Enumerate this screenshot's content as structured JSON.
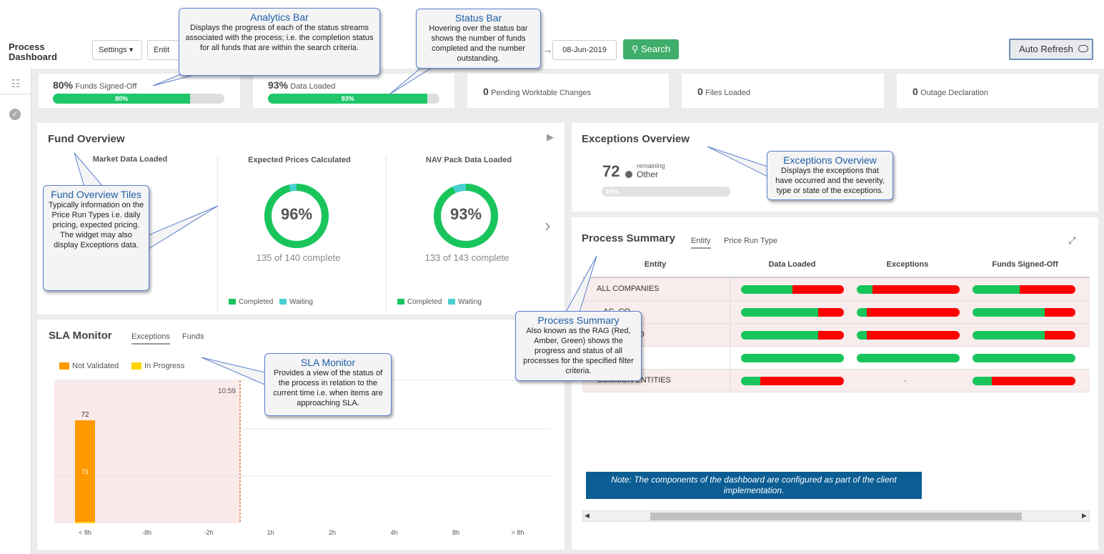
{
  "header": {
    "title": "Process Dashboard",
    "settings_label": "Settings ▾",
    "entity_stub": "Entit",
    "date": "08-Jun-2019",
    "search_label": "Search",
    "auto_refresh_label": "Auto Refresh"
  },
  "stats": [
    {
      "value": "80%",
      "label": "Funds Signed-Off",
      "bar_text": "80%",
      "progress": 0.8
    },
    {
      "value": "93%",
      "label": "Data Loaded",
      "bar_text": "93%",
      "progress": 0.93
    },
    {
      "value": "0",
      "label": "Pending Worktable Changes"
    },
    {
      "value": "0",
      "label": "Files Loaded"
    },
    {
      "value": "0",
      "label": "Outage Declaration"
    }
  ],
  "fund_overview": {
    "title": "Fund Overview",
    "tiles": [
      {
        "title": "Market Data Loaded"
      },
      {
        "title": "Expected Prices Calculated",
        "pct": "96%",
        "fraction": 0.96,
        "sub": "135 of 140 complete",
        "legend_completed": "Completed",
        "legend_waiting": "Waiting"
      },
      {
        "title": "NAV Pack Data Loaded",
        "pct": "93%",
        "fraction": 0.93,
        "sub": "133 of 143 complete",
        "legend_completed": "Completed",
        "legend_waiting": "Waiting"
      }
    ]
  },
  "exceptions_overview": {
    "title": "Exceptions Overview",
    "count": "72",
    "remaining": "remaining",
    "type": "Other",
    "bar_text": "16%",
    "progress": 0.16
  },
  "process_summary": {
    "title": "Process Summary",
    "tab_entity": "Entity",
    "tab_price_run": "Price Run Type",
    "columns": [
      "Entity",
      "Data Loaded",
      "Exceptions",
      "Funds Signed-Off"
    ],
    "rows": [
      {
        "label": "ALL COMPANIES",
        "data_loaded": 0.5,
        "exceptions": 0.15,
        "funds": 0.46
      },
      {
        "label": "...AC_CO",
        "data_loaded": 0.75,
        "exceptions": 0.1,
        "funds": 0.7
      },
      {
        "label": "EMEA  DEMO",
        "data_loaded": 0.75,
        "exceptions": 0.1,
        "funds": 0.7
      },
      {
        "label": "...SES",
        "data_loaded": 1.0,
        "exceptions": 1.0,
        "funds": 1.0
      },
      {
        "label": "COMMON  ENTITIES",
        "data_loaded": 0.19,
        "exceptions": null,
        "exceptions_text": "-",
        "funds": 0.19
      }
    ]
  },
  "sla_monitor": {
    "title": "SLA Monitor",
    "tab_exceptions": "Exceptions",
    "tab_funds": "Funds",
    "legend_not_validated": "Not Validated",
    "legend_in_progress": "In Progress",
    "now_label": "10:59"
  },
  "chart_data": {
    "type": "bar",
    "categories": [
      "< 8h",
      "-8h",
      "-2h",
      "1h",
      "2h",
      "4h",
      "8h",
      "> 8h"
    ],
    "series": [
      {
        "name": "Not Validated",
        "values": [
          71,
          0,
          0,
          0,
          0,
          0,
          0,
          0
        ]
      },
      {
        "name": "In Progress",
        "values": [
          1,
          0,
          0,
          0,
          0,
          0,
          0,
          0
        ]
      }
    ],
    "totals": [
      72,
      0,
      0,
      0,
      0,
      0,
      0,
      0
    ],
    "ylim": [
      0,
      100
    ],
    "grid": true,
    "legend": "top-left",
    "colors": {
      "not_validated": "#ff9900",
      "in_progress": "#ffd400",
      "overdue_zone": "#fbeaea",
      "now_line": "#d05a2a"
    }
  },
  "callouts": {
    "analytics": {
      "title": "Analytics Bar",
      "body": "Displays the progress of each of the status streams associated with the process; i.e. the completion status for all funds that are within the search criteria."
    },
    "status": {
      "title": "Status Bar",
      "body": "Hovering over the status bar shows the number of funds completed and the number outstanding."
    },
    "fund_tiles": {
      "title": "Fund Overview Tiles",
      "body": "Typically information on the Price Run Types i.e. daily pricing, expected pricing. The widget may also display Exceptions data."
    },
    "exceptions": {
      "title": "Exceptions Overview",
      "body": "Displays the exceptions that have occurred and the severity, type or state of the exceptions."
    },
    "process_summary": {
      "title": "Process Summary",
      "body": "Also known as the RAG (Red, Amber, Green) shows the progress and status of all processes for the specified filter criteria."
    },
    "sla": {
      "title": "SLA Monitor",
      "body": "Provides a view of the status of the process in relation to the current time i.e. when items are approaching SLA."
    }
  },
  "note": "Note: The components of the dashboard are configured as part of the client implementation.",
  "colors": {
    "green": "#19c55b",
    "red": "#ff0000",
    "accent": "#3fae6a",
    "teal": "#49cfcf"
  }
}
